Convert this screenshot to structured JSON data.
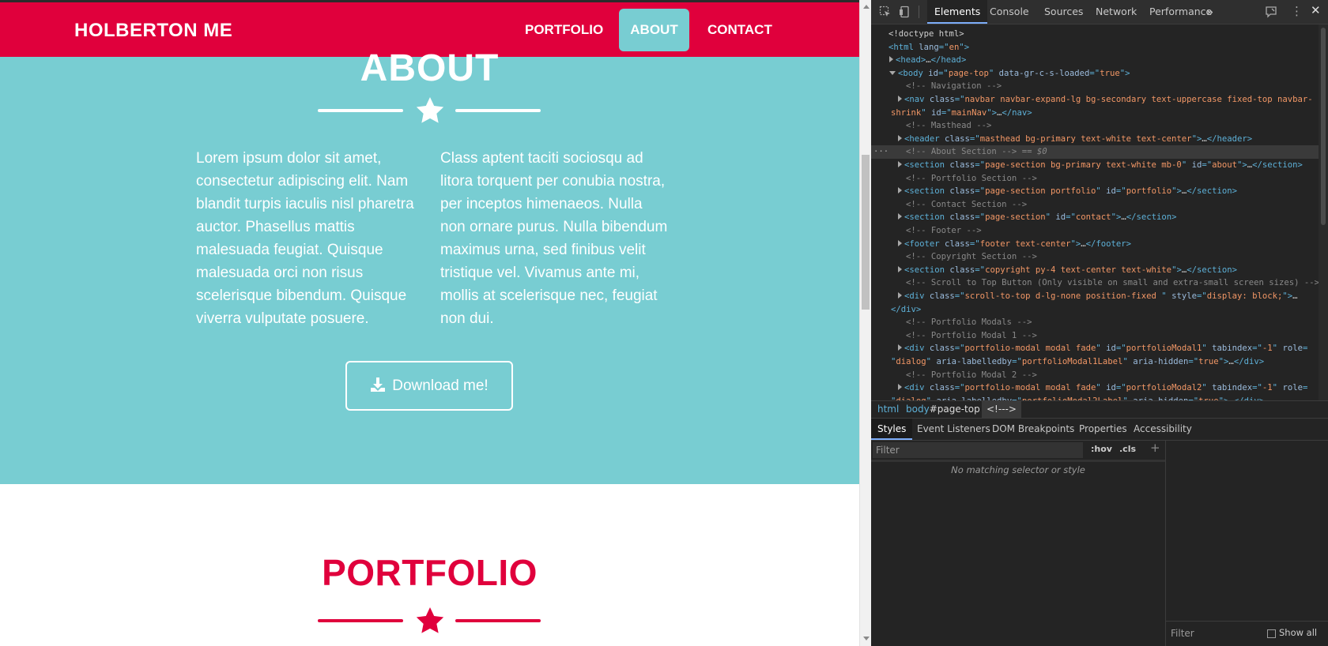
{
  "page": {
    "navbar": {
      "brand": "HOLBERTON ME",
      "links": [
        "PORTFOLIO",
        "ABOUT",
        "CONTACT"
      ],
      "active_link": "ABOUT"
    },
    "about": {
      "title": "ABOUT",
      "left_text": "Lorem ipsum dolor sit amet, consectetur adipiscing elit. Nam blandit turpis iaculis nisl pharetra auctor. Phasellus mattis malesuada feugiat. Quisque malesuada orci non risus scelerisque bibendum. Quisque viverra vulputate posuere.",
      "right_text": "Class aptent taciti sociosqu ad litora torquent per conubia nostra, per inceptos himenaeos. Nulla non ornare purus. Nulla bibendum maximus urna, sed finibus velit tristique vel. Vivamus ante mi, mollis at scelerisque nec, feugiat non dui.",
      "download_label": "Download me!"
    },
    "portfolio": {
      "title": "PORTFOLIO"
    },
    "colors": {
      "primary": "#e0003c",
      "secondary": "#78cdd2",
      "text_white": "#ffffff"
    }
  },
  "devtools": {
    "tabs": [
      "Elements",
      "Console",
      "Sources",
      "Network",
      "Performance"
    ],
    "active_tab": "Elements",
    "more_tabs": "»",
    "dom_lines": [
      {
        "indent": 0,
        "tri": "",
        "html": "<span class=\"c-txt\">&lt;!doctype html&gt;</span>"
      },
      {
        "indent": 0,
        "tri": "",
        "html": "<span class=\"c-tag\">&lt;html </span><span class=\"c-attr\">lang</span><span class=\"c-tag\">=\"</span><span class=\"c-val\">en</span><span class=\"c-tag\">\"&gt;</span>"
      },
      {
        "indent": 1,
        "tri": "closed",
        "html": "<span class=\"c-tag\">&lt;head&gt;</span><span class=\"c-txt\">…</span><span class=\"c-tag\">&lt;/head&gt;</span>"
      },
      {
        "indent": 1,
        "tri": "open",
        "html": "<span class=\"c-tag\">&lt;body </span><span class=\"c-attr\">id</span><span class=\"c-tag\">=\"</span><span class=\"c-val\">page-top</span><span class=\"c-tag\">\" </span><span class=\"c-attr\">data-gr-c-s-loaded</span><span class=\"c-tag\">=\"</span><span class=\"c-val\">true</span><span class=\"c-tag\">\"&gt;</span>"
      },
      {
        "indent": 2,
        "tri": "",
        "html": "<span class=\"c-cmt\">&lt;!-- Navigation --&gt;</span>"
      },
      {
        "indent": 2,
        "tri": "closed",
        "html": "<span class=\"c-tag\">&lt;nav </span><span class=\"c-attr\">class</span><span class=\"c-tag\">=\"</span><span class=\"c-val\">navbar navbar-expand-lg bg-secondary text-uppercase fixed-top navbar-</span>"
      },
      {
        "indent": 2,
        "tri": "",
        "html": "<span class=\"c-val\">shrink</span><span class=\"c-tag\">\" </span><span class=\"c-attr\">id</span><span class=\"c-tag\">=\"</span><span class=\"c-val\">mainNav</span><span class=\"c-tag\">\"&gt;</span><span class=\"c-txt\">…</span><span class=\"c-tag\">&lt;/nav&gt;</span>",
        "wrap": true
      },
      {
        "indent": 2,
        "tri": "",
        "html": "<span class=\"c-cmt\">&lt;!-- Masthead --&gt;</span>"
      },
      {
        "indent": 2,
        "tri": "closed",
        "html": "<span class=\"c-tag\">&lt;header </span><span class=\"c-attr\">class</span><span class=\"c-tag\">=\"</span><span class=\"c-val\">masthead bg-primary text-white text-center</span><span class=\"c-tag\">\"&gt;</span><span class=\"c-txt\">…</span><span class=\"c-tag\">&lt;/header&gt;</span>"
      },
      {
        "indent": 2,
        "tri": "",
        "html": "<span class=\"c-cmt\">&lt;!-- About Section --&gt; == <i>$0</i></span>",
        "selected": true
      },
      {
        "indent": 2,
        "tri": "closed",
        "html": "<span class=\"c-tag\">&lt;section </span><span class=\"c-attr\">class</span><span class=\"c-tag\">=\"</span><span class=\"c-val\">page-section bg-primary text-white mb-0</span><span class=\"c-tag\">\" </span><span class=\"c-attr\">id</span><span class=\"c-tag\">=\"</span><span class=\"c-val\">about</span><span class=\"c-tag\">\"&gt;</span><span class=\"c-txt\">…</span><span class=\"c-tag\">&lt;/section&gt;</span>"
      },
      {
        "indent": 2,
        "tri": "",
        "html": "<span class=\"c-cmt\">&lt;!-- Portfolio Section --&gt;</span>"
      },
      {
        "indent": 2,
        "tri": "closed",
        "html": "<span class=\"c-tag\">&lt;section </span><span class=\"c-attr\">class</span><span class=\"c-tag\">=\"</span><span class=\"c-val\">page-section portfolio</span><span class=\"c-tag\">\" </span><span class=\"c-attr\">id</span><span class=\"c-tag\">=\"</span><span class=\"c-val\">portfolio</span><span class=\"c-tag\">\"&gt;</span><span class=\"c-txt\">…</span><span class=\"c-tag\">&lt;/section&gt;</span>"
      },
      {
        "indent": 2,
        "tri": "",
        "html": "<span class=\"c-cmt\">&lt;!-- Contact Section --&gt;</span>"
      },
      {
        "indent": 2,
        "tri": "closed",
        "html": "<span class=\"c-tag\">&lt;section </span><span class=\"c-attr\">class</span><span class=\"c-tag\">=\"</span><span class=\"c-val\">page-section</span><span class=\"c-tag\">\" </span><span class=\"c-attr\">id</span><span class=\"c-tag\">=\"</span><span class=\"c-val\">contact</span><span class=\"c-tag\">\"&gt;</span><span class=\"c-txt\">…</span><span class=\"c-tag\">&lt;/section&gt;</span>"
      },
      {
        "indent": 2,
        "tri": "",
        "html": "<span class=\"c-cmt\">&lt;!-- Footer --&gt;</span>"
      },
      {
        "indent": 2,
        "tri": "closed",
        "html": "<span class=\"c-tag\">&lt;footer </span><span class=\"c-attr\">class</span><span class=\"c-tag\">=\"</span><span class=\"c-val\">footer text-center</span><span class=\"c-tag\">\"&gt;</span><span class=\"c-txt\">…</span><span class=\"c-tag\">&lt;/footer&gt;</span>"
      },
      {
        "indent": 2,
        "tri": "",
        "html": "<span class=\"c-cmt\">&lt;!-- Copyright Section --&gt;</span>"
      },
      {
        "indent": 2,
        "tri": "closed",
        "html": "<span class=\"c-tag\">&lt;section </span><span class=\"c-attr\">class</span><span class=\"c-tag\">=\"</span><span class=\"c-val\">copyright py-4 text-center text-white</span><span class=\"c-tag\">\"&gt;</span><span class=\"c-txt\">…</span><span class=\"c-tag\">&lt;/section&gt;</span>"
      },
      {
        "indent": 2,
        "tri": "",
        "html": "<span class=\"c-cmt\">&lt;!-- Scroll to Top Button (Only visible on small and extra-small screen sizes) --&gt;</span>"
      },
      {
        "indent": 2,
        "tri": "closed",
        "html": "<span class=\"c-tag\">&lt;div </span><span class=\"c-attr\">class</span><span class=\"c-tag\">=\"</span><span class=\"c-val\">scroll-to-top d-lg-none position-fixed </span><span class=\"c-tag\">\" </span><span class=\"c-attr\">style</span><span class=\"c-tag\">=\"</span><span class=\"c-val\">display: block;</span><span class=\"c-tag\">\"&gt;</span><span class=\"c-txt\">…</span>"
      },
      {
        "indent": 2,
        "tri": "",
        "html": "<span class=\"c-tag\">&lt;/div&gt;</span>",
        "wrap": true
      },
      {
        "indent": 2,
        "tri": "",
        "html": "<span class=\"c-cmt\">&lt;!-- Portfolio Modals --&gt;</span>"
      },
      {
        "indent": 2,
        "tri": "",
        "html": "<span class=\"c-cmt\">&lt;!-- Portfolio Modal 1 --&gt;</span>"
      },
      {
        "indent": 2,
        "tri": "closed",
        "html": "<span class=\"c-tag\">&lt;div </span><span class=\"c-attr\">class</span><span class=\"c-tag\">=\"</span><span class=\"c-val\">portfolio-modal modal fade</span><span class=\"c-tag\">\" </span><span class=\"c-attr\">id</span><span class=\"c-tag\">=\"</span><span class=\"c-val\">portfolioModal1</span><span class=\"c-tag\">\" </span><span class=\"c-attr\">tabindex</span><span class=\"c-tag\">=\"</span><span class=\"c-val\">-1</span><span class=\"c-tag\">\" </span><span class=\"c-attr\">role</span><span class=\"c-tag\">=</span>"
      },
      {
        "indent": 2,
        "tri": "",
        "html": "<span class=\"c-tag\">\"</span><span class=\"c-val\">dialog</span><span class=\"c-tag\">\" </span><span class=\"c-attr\">aria-labelledby</span><span class=\"c-tag\">=\"</span><span class=\"c-val\">portfolioModal1Label</span><span class=\"c-tag\">\" </span><span class=\"c-attr\">aria-hidden</span><span class=\"c-tag\">=\"</span><span class=\"c-val\">true</span><span class=\"c-tag\">\"&gt;</span><span class=\"c-txt\">…</span><span class=\"c-tag\">&lt;/div&gt;</span>",
        "wrap": true
      },
      {
        "indent": 2,
        "tri": "",
        "html": "<span class=\"c-cmt\">&lt;!-- Portfolio Modal 2 --&gt;</span>"
      },
      {
        "indent": 2,
        "tri": "closed",
        "html": "<span class=\"c-tag\">&lt;div </span><span class=\"c-attr\">class</span><span class=\"c-tag\">=\"</span><span class=\"c-val\">portfolio-modal modal fade</span><span class=\"c-tag\">\" </span><span class=\"c-attr\">id</span><span class=\"c-tag\">=\"</span><span class=\"c-val\">portfolioModal2</span><span class=\"c-tag\">\" </span><span class=\"c-attr\">tabindex</span><span class=\"c-tag\">=\"</span><span class=\"c-val\">-1</span><span class=\"c-tag\">\" </span><span class=\"c-attr\">role</span><span class=\"c-tag\">=</span>"
      },
      {
        "indent": 2,
        "tri": "",
        "html": "<span class=\"c-tag\">\"</span><span class=\"c-val\">dialog</span><span class=\"c-tag\">\" </span><span class=\"c-attr\">aria-labelledby</span><span class=\"c-tag\">=\"</span><span class=\"c-val\">portfolioModal2Label</span><span class=\"c-tag\">\" </span><span class=\"c-attr\">aria-hidden</span><span class=\"c-tag\">=\"</span><span class=\"c-val\">true</span><span class=\"c-tag\">\"&gt;</span><span class=\"c-txt\">…</span><span class=\"c-tag\">&lt;/div&gt;</span>",
        "wrap": true
      }
    ],
    "breadcrumbs": {
      "html": "html",
      "body": "body",
      "body_id": "#page-top",
      "comment": "<!--->"
    },
    "styles_tabs": [
      "Styles",
      "Event Listeners",
      "DOM Breakpoints",
      "Properties",
      "Accessibility"
    ],
    "active_styles_tab": "Styles",
    "styles_filter_placeholder": "Filter",
    "hov_label": ":hov",
    "cls_label": ".cls",
    "plus_label": "+",
    "no_match_text": "No matching selector or style",
    "computed_filter_placeholder": "Filter",
    "show_all_label": "Show all",
    "dots": "···"
  }
}
